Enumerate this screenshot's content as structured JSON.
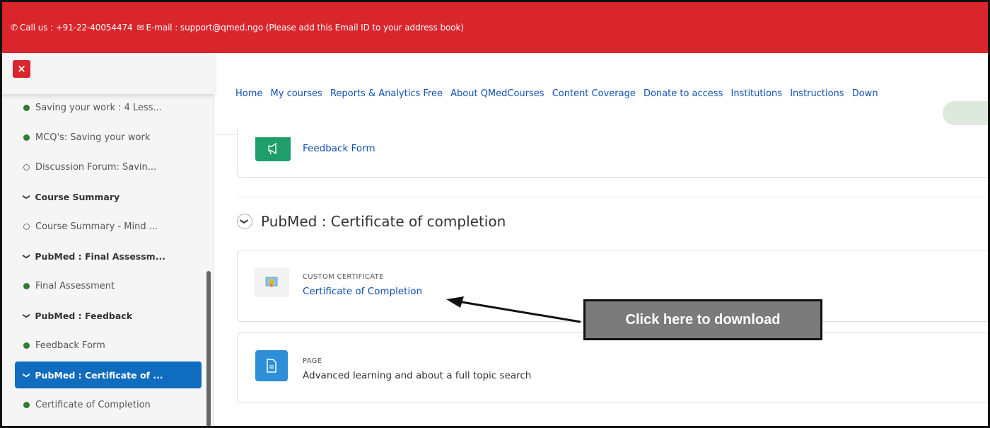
{
  "topbar": {
    "phone_label": "Call us : +91-22-40054474",
    "email_label": "E-mail : support@qmed.ngo (Please add this Email ID to your address book)"
  },
  "sidebar": {
    "close_label": "×",
    "items": [
      {
        "label": "Saving your work : 4 Less...",
        "kind": "item",
        "status": "complete"
      },
      {
        "label": "MCQ's: Saving your work",
        "kind": "item",
        "status": "complete"
      },
      {
        "label": "Discussion Forum: Savin...",
        "kind": "item",
        "status": "incomplete"
      },
      {
        "label": "Course Summary",
        "kind": "section"
      },
      {
        "label": "Course Summary - Mind ...",
        "kind": "item",
        "status": "incomplete"
      },
      {
        "label": "PubMed : Final Assessm...",
        "kind": "section"
      },
      {
        "label": "Final Assessment",
        "kind": "item",
        "status": "complete"
      },
      {
        "label": "PubMed : Feedback",
        "kind": "section"
      },
      {
        "label": "Feedback Form",
        "kind": "item",
        "status": "complete"
      },
      {
        "label": "PubMed : Certificate of ...",
        "kind": "section",
        "active": true
      },
      {
        "label": "Certificate of Completion",
        "kind": "item",
        "status": "complete"
      }
    ]
  },
  "nav": {
    "items": [
      "Home",
      "My courses",
      "Reports & Analytics Free",
      "About QMedCourses",
      "Content Coverage",
      "Donate to access",
      "Institutions",
      "Instructions",
      "Down"
    ]
  },
  "content": {
    "feedback": {
      "link": "Feedback Form"
    },
    "section_title": "PubMed : Certificate of completion",
    "certificate": {
      "type": "CUSTOM CERTIFICATE",
      "link": "Certificate of Completion"
    },
    "page": {
      "type": "PAGE",
      "text": "Advanced learning and about a full topic search"
    }
  },
  "callout": {
    "text": "Click here to download"
  },
  "colors": {
    "topbar": "#d9252c",
    "link": "#0f4fb6",
    "active": "#0f6cbf",
    "feedback_icon": "#1f9d6b",
    "page_icon": "#2d8fd8",
    "complete_dot": "#2e7d32"
  }
}
